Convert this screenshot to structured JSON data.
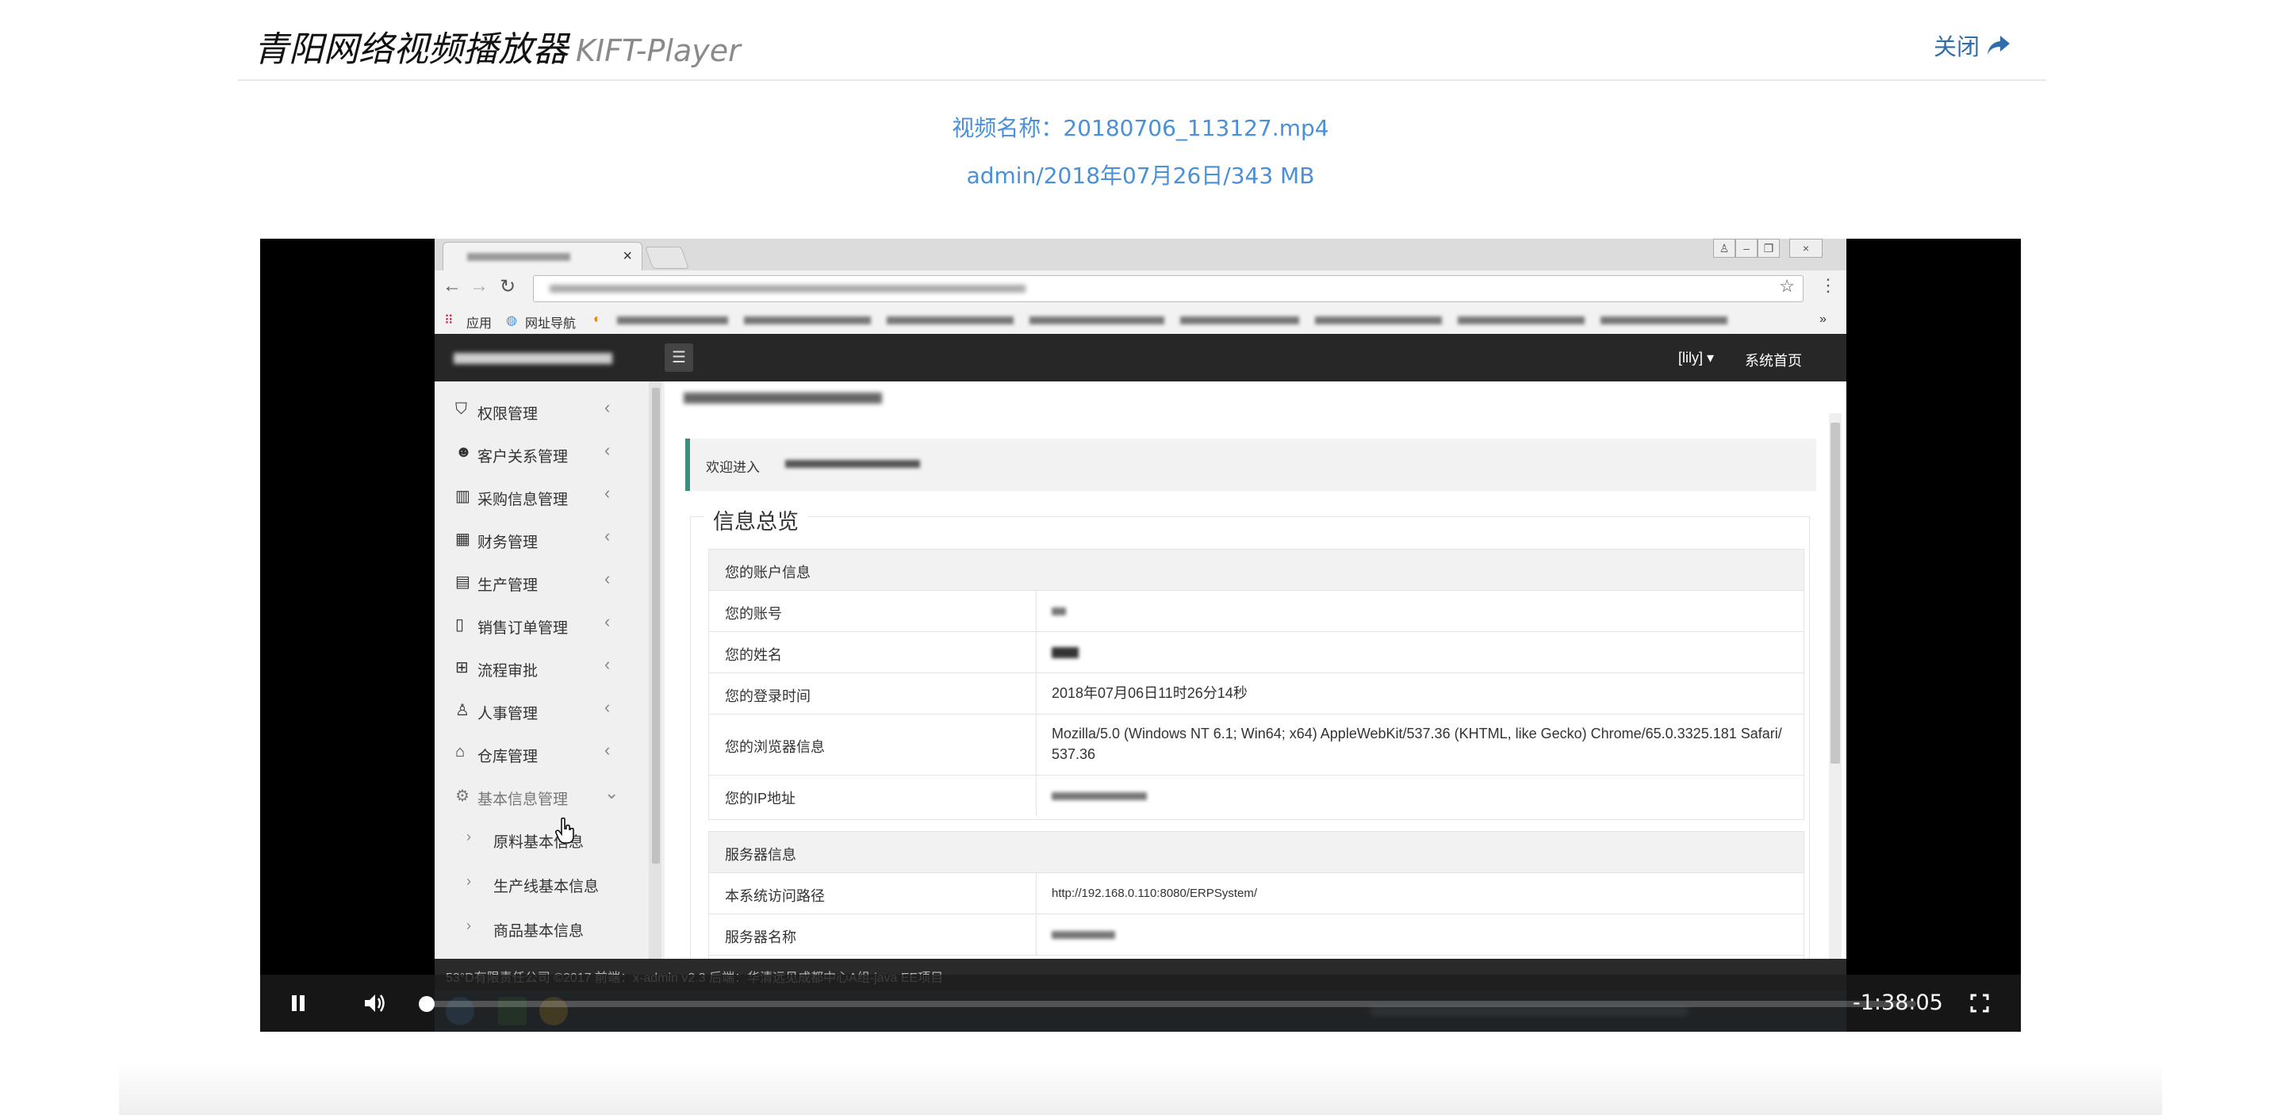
{
  "header": {
    "title": "青阳网络视频播放器",
    "subtitle": "KIFT-Player",
    "close_label": "关闭"
  },
  "video_info": {
    "name_line": "视频名称：20180706_113127.mp4",
    "meta_line": "admin/2018年07月26日/343 MB"
  },
  "player": {
    "time_remaining": "-1:38:05",
    "progress_fraction": 0.0,
    "state": "playing"
  },
  "screen": {
    "bookmarks": {
      "apps_label": "应用",
      "nav_label": "网址导航"
    },
    "app_header": {
      "user_label": "[lily]",
      "home_label": "系统首页"
    },
    "sidebar": {
      "items": [
        {
          "label": "权限管理",
          "icon": "shield-icon"
        },
        {
          "label": "客户关系管理",
          "icon": "users-icon"
        },
        {
          "label": "采购信息管理",
          "icon": "barcode-icon"
        },
        {
          "label": "财务管理",
          "icon": "calculator-icon"
        },
        {
          "label": "生产管理",
          "icon": "building-icon"
        },
        {
          "label": "销售订单管理",
          "icon": "receipt-icon"
        },
        {
          "label": "流程审批",
          "icon": "sitemap-icon"
        },
        {
          "label": "人事管理",
          "icon": "person-icon"
        },
        {
          "label": "仓库管理",
          "icon": "home-icon"
        },
        {
          "label": "基本信息管理",
          "icon": "gear-icon"
        }
      ],
      "sub_items": [
        {
          "label": "原料基本信息"
        },
        {
          "label": "生产线基本信息"
        },
        {
          "label": "商品基本信息"
        }
      ]
    },
    "content": {
      "welcome_label": "欢迎进入",
      "overview_title": "信息总览",
      "account_section": {
        "title": "您的账户信息",
        "rows": [
          {
            "label": "您的账号",
            "value": ""
          },
          {
            "label": "您的姓名",
            "value": ""
          },
          {
            "label": "您的登录时间",
            "value": "2018年07月06日11时26分14秒"
          },
          {
            "label": "您的浏览器信息",
            "value": "Mozilla/5.0 (Windows NT 6.1; Win64; x64) AppleWebKit/537.36 (KHTML, like Gecko) Chrome/65.0.3325.181 Safari/537.36"
          },
          {
            "label": "您的IP地址",
            "value": ""
          }
        ]
      },
      "server_section": {
        "title": "服务器信息",
        "rows": [
          {
            "label": "本系统访问路径",
            "value": "http://192.168.0.110:8080/ERPSystem/"
          },
          {
            "label": "服务器名称",
            "value": ""
          }
        ]
      }
    },
    "footer_text": "53°D有限责任公司 ©2017 前端：x-admin v2.3 后端：华清远见成都中心A组-java EE项目"
  },
  "colors": {
    "link": "#4a90d9",
    "close_link": "#2f6ea8",
    "app_header": "#272727",
    "accent": "#3b8e7e",
    "player_bg": "#000000"
  }
}
